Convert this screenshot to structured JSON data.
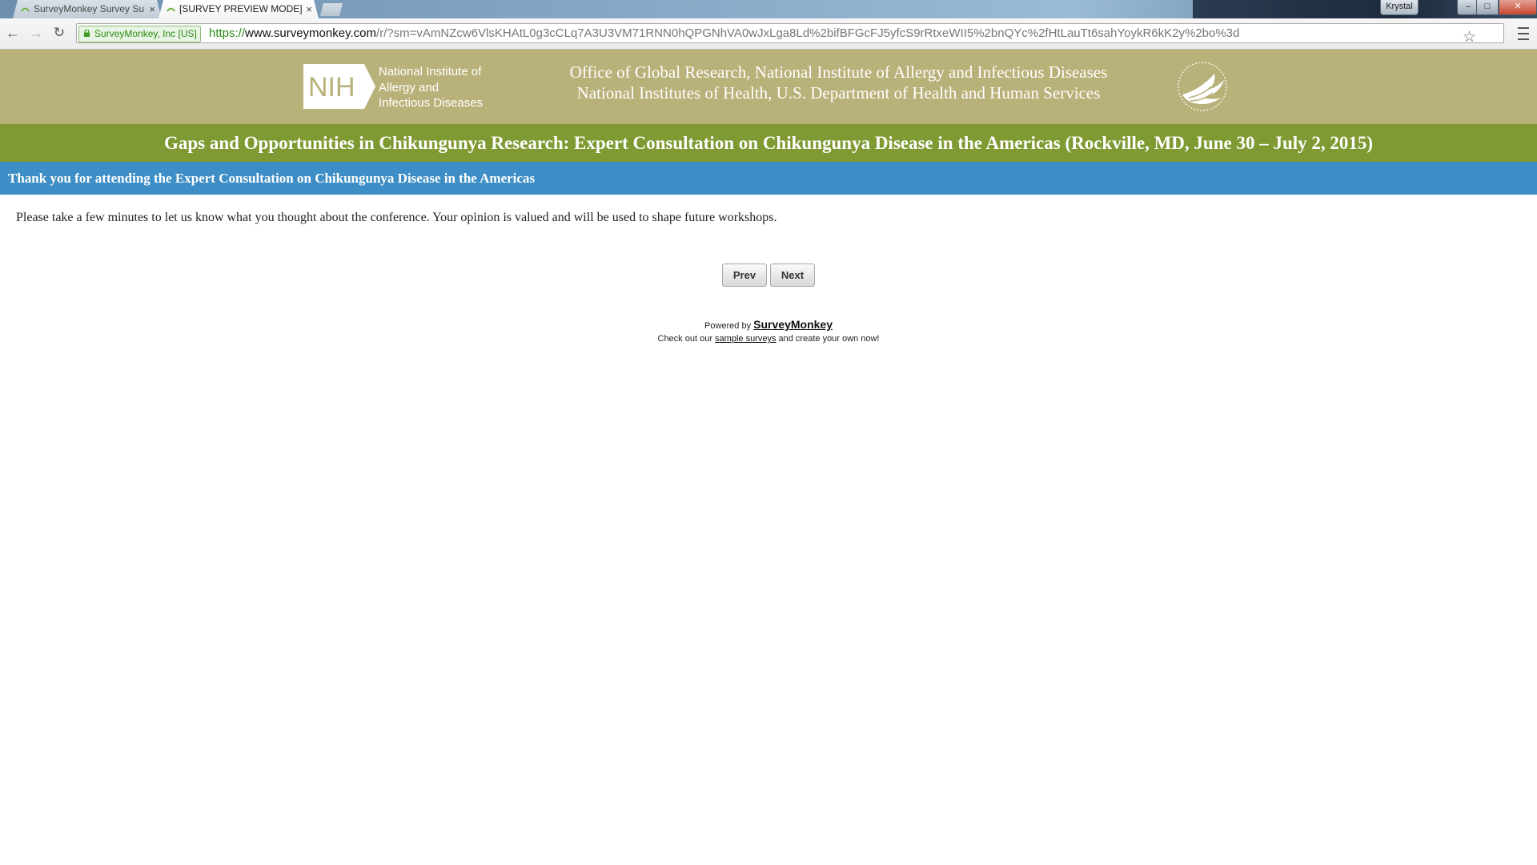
{
  "browser": {
    "tabs": [
      {
        "title": "SurveyMonkey Survey Su",
        "active": false
      },
      {
        "title": "[SURVEY PREVIEW MODE]",
        "active": true
      }
    ],
    "close_glyph": "×",
    "profile_name": "Krystal",
    "window_controls": {
      "minimize": "–",
      "maximize": "□",
      "close": "✕"
    },
    "ev_cert": "SurveyMonkey, Inc [US]",
    "url": {
      "scheme": "https://",
      "host": "www.surveymonkey.com",
      "path": "/r/?sm=vAmNZcw6VlsKHAtL0g3cCLq7A3U3VM71RNN0hQPGNhVA0wJxLga8Ld%2bifBFGcFJ5yfcS9rRtxeWII5%2bnQYc%2fHtLauTt6sahYoykR6kK2y%2bo%3d"
    },
    "icons": {
      "back": "←",
      "forward": "→",
      "reload": "↻",
      "bookmark": "☆"
    }
  },
  "header": {
    "logo_abbrev": "NIH",
    "institute_lines": [
      "National Institute of",
      "Allergy and",
      "Infectious Diseases"
    ],
    "office_line1": "Office of Global Research, National Institute of Allergy and Infectious Diseases",
    "office_line2": "National Institutes of Health, U.S. Department of Health and Human Services"
  },
  "survey": {
    "title": "Gaps and Opportunities in Chikungunya Research: Expert Consultation on Chikungunya Disease in the Americas (Rockville, MD, June 30 – July 2, 2015)",
    "page_heading": "Thank you for attending the Expert Consultation on Chikungunya Disease in the Americas",
    "intro_text": "Please take a few minutes to let us know what you thought about the conference. Your opinion is valued and will be used to shape future workshops.",
    "prev_label": "Prev",
    "next_label": "Next"
  },
  "footer": {
    "powered_by": "Powered by ",
    "brand": "SurveyMonkey",
    "check_prefix": "Check out our ",
    "sample_link": "sample surveys",
    "check_suffix": " and create your own now!"
  },
  "colors": {
    "banner_tan": "#b9b17a",
    "title_green": "#7f9a32",
    "header_blue": "#3d8ec6"
  }
}
